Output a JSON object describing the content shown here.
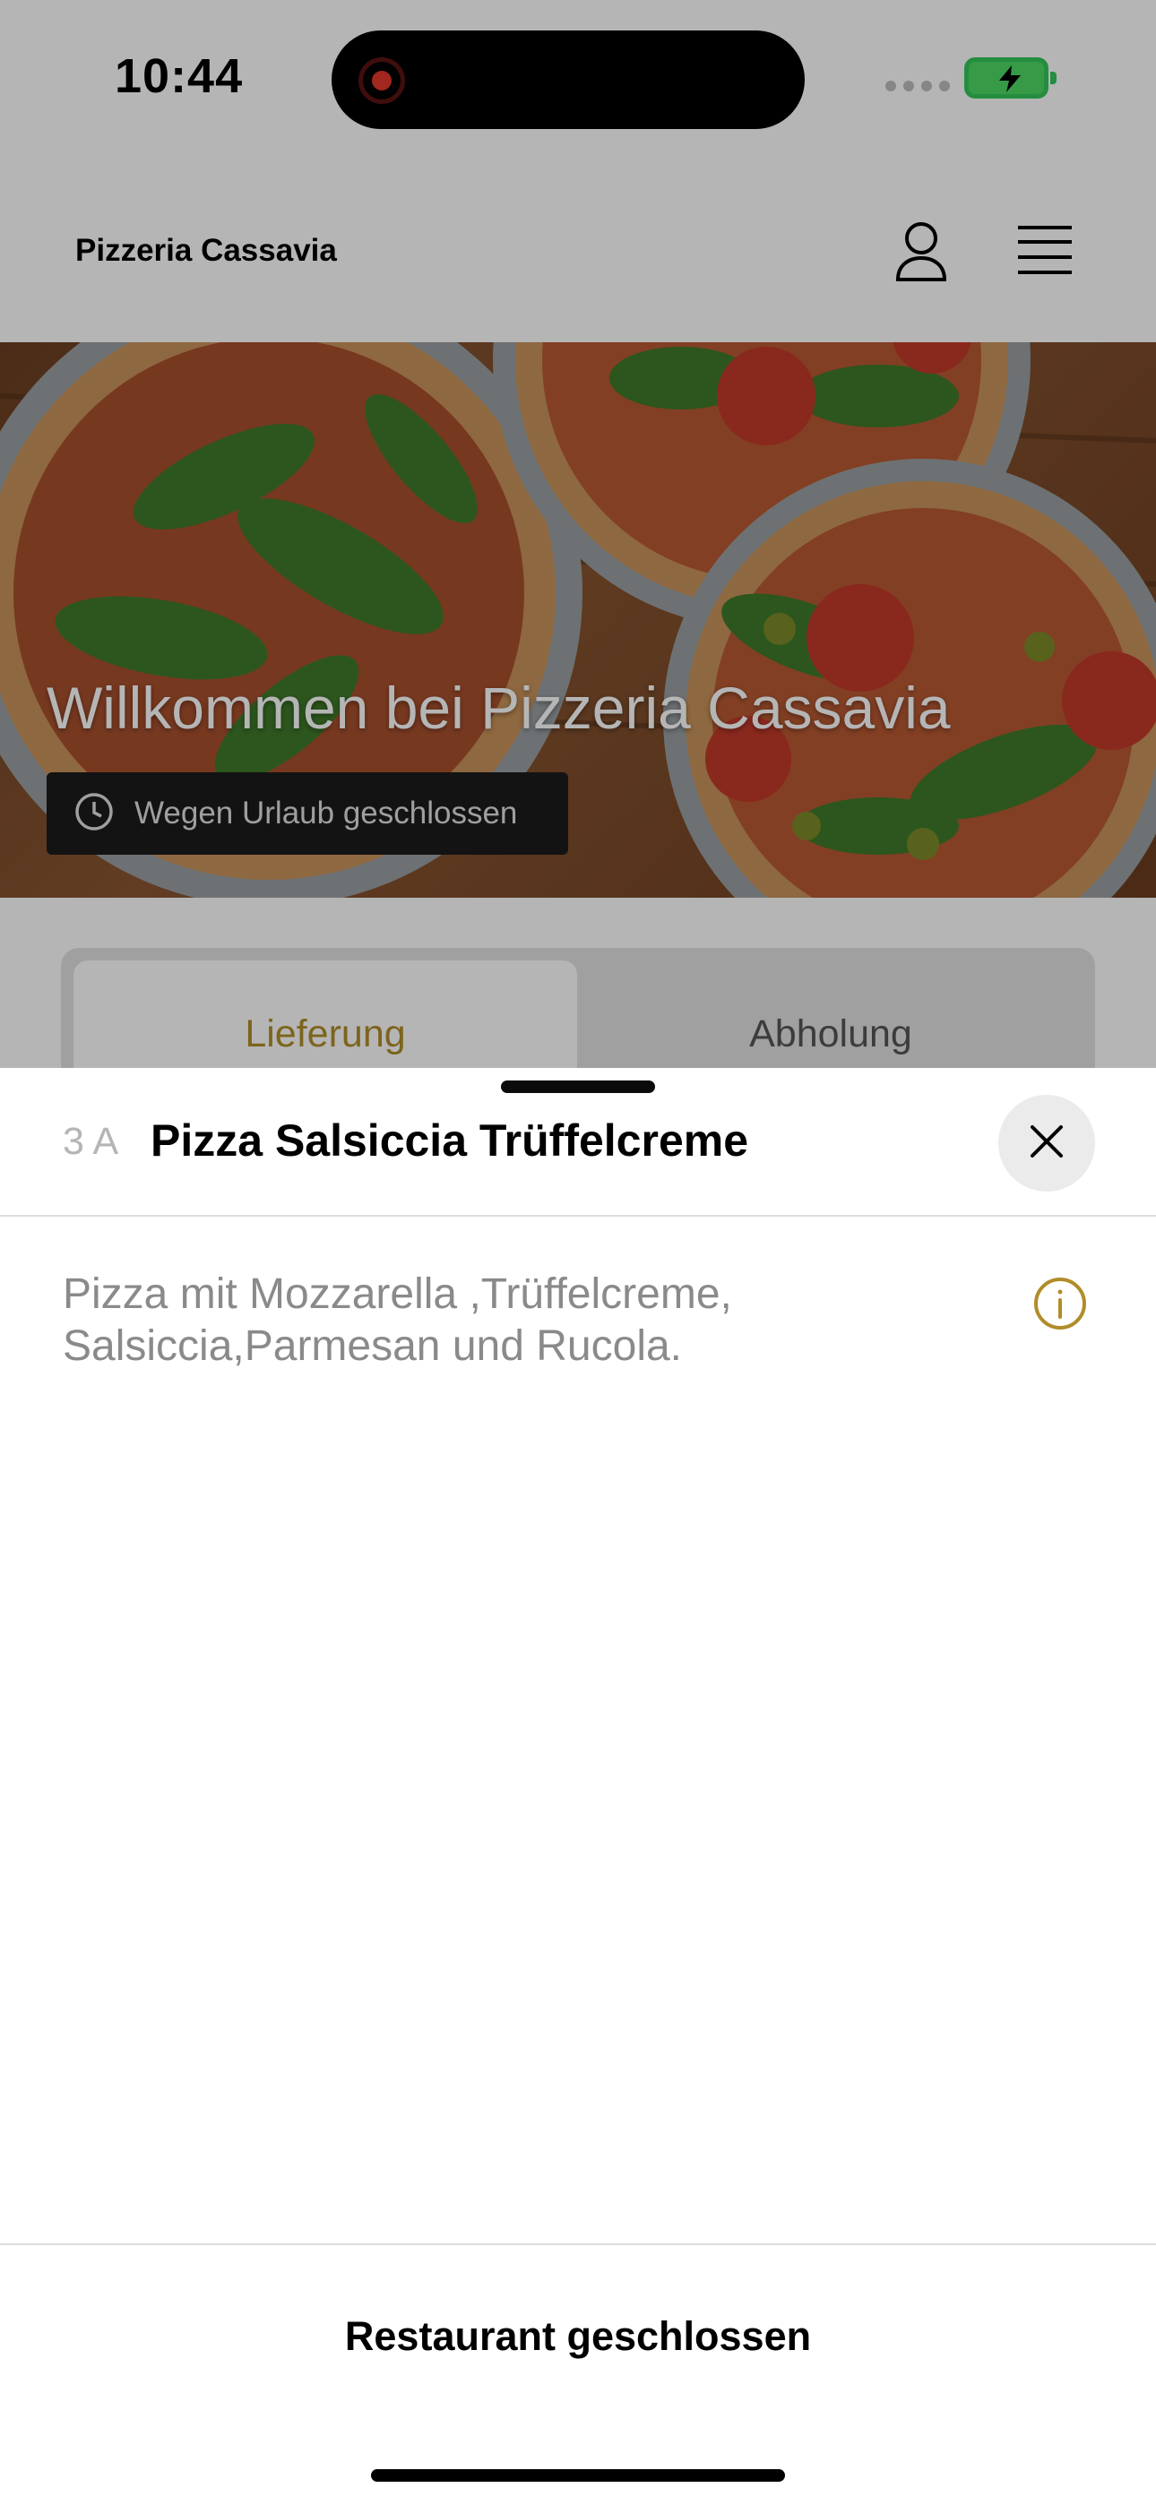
{
  "status_bar": {
    "time": "10:44"
  },
  "header": {
    "brand": "Pizzeria Cassavia"
  },
  "hero": {
    "title": "Willkommen bei Pizzeria Cassavia",
    "status_badge": "Wegen Urlaub geschlossen"
  },
  "tabs": [
    {
      "label": "Lieferung",
      "active": true
    },
    {
      "label": "Abholung",
      "active": false
    }
  ],
  "sheet": {
    "item_number": "3 A",
    "item_title": "Pizza Salsiccia Trüffelcreme",
    "description": "Pizza mit Mozzarella ,Trüffelcreme, Salsiccia,Parmesan und Rucola.",
    "footer_label": "Restaurant geschlossen"
  },
  "icons": {
    "user": "user-icon",
    "menu": "hamburger-menu-icon",
    "clock": "clock-icon",
    "close": "close-icon",
    "info": "info-icon",
    "record": "screen-record-icon",
    "battery": "battery-charging-icon"
  },
  "colors": {
    "accent": "#b08d2a",
    "battery": "#4cd964",
    "record": "#e5372b"
  }
}
